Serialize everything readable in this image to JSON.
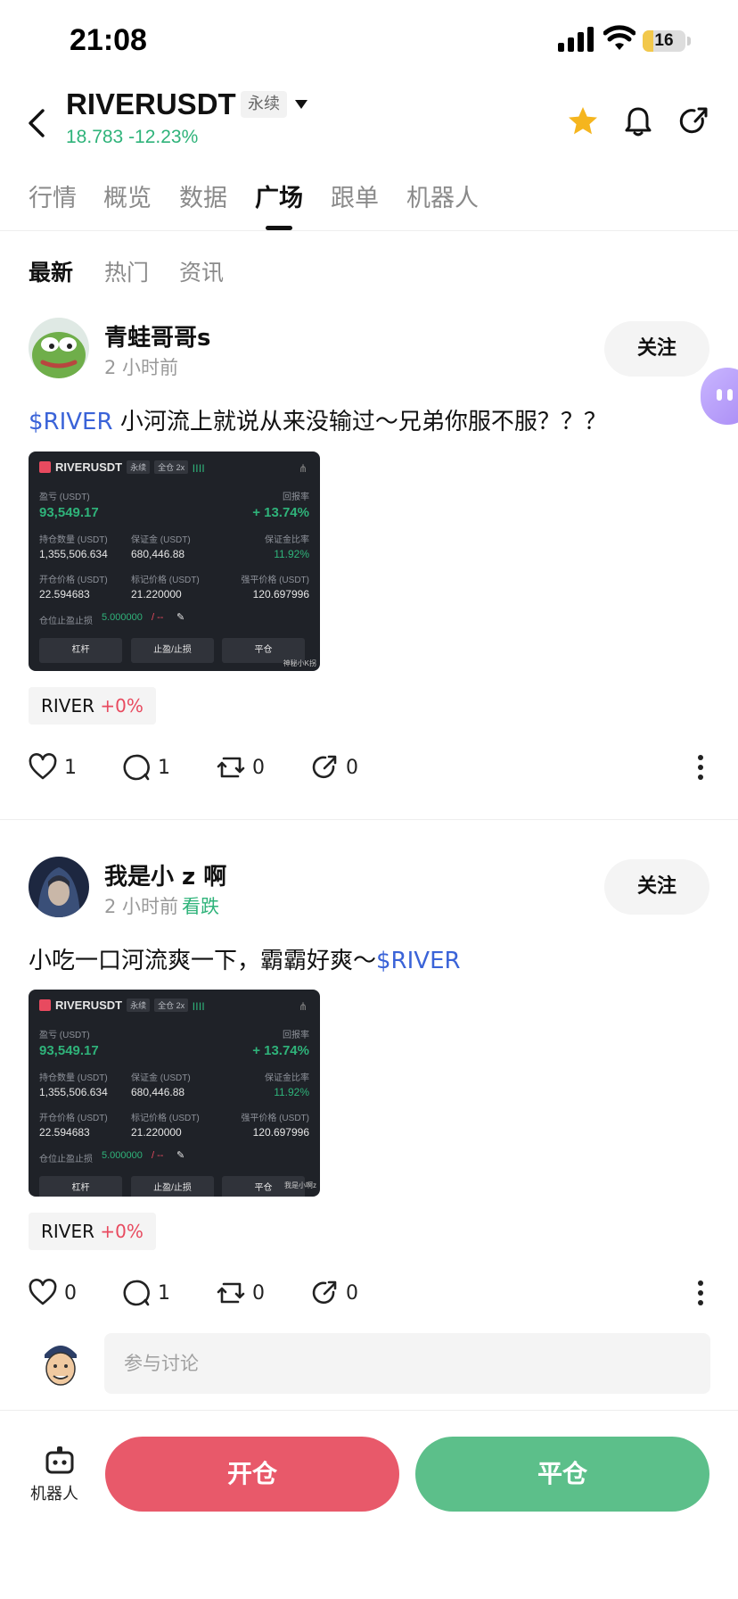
{
  "status_bar": {
    "time": "21:08",
    "battery": "16"
  },
  "header": {
    "title": "RIVERUSDT",
    "badge": "永续",
    "price_line": "18.783 -12.23%"
  },
  "tabs": [
    "行情",
    "概览",
    "数据",
    "广场",
    "跟单",
    "机器人"
  ],
  "active_tab": "广场",
  "subtabs": [
    "最新",
    "热门",
    "资讯"
  ],
  "active_subtab": "最新",
  "posts": [
    {
      "username": "青蛙哥哥s",
      "time": "2 小时前",
      "sentiment": "",
      "follow": "关注",
      "ticker": "$RIVER",
      "text_after": " 小河流上就说从来没输过～兄弟你服不服？？？",
      "card": {
        "symbol": "RIVERUSDT",
        "perp": "永续",
        "margin": "全仓 2x",
        "pnl_label": "盈亏 (USDT)",
        "pnl": "93,549.17",
        "roe_label": "回报率",
        "roe": "+ 13.74%",
        "qty_label": "持仓数量 (USDT)",
        "qty": "1,355,506.634",
        "margin_label": "保证金 (USDT)",
        "margin_val": "680,446.88",
        "ratio_label": "保证金比率",
        "ratio": "11.92%",
        "entry_label": "开仓价格 (USDT)",
        "entry": "22.594683",
        "mark_label": "标记价格 (USDT)",
        "mark": "21.220000",
        "liq_label": "强平价格 (USDT)",
        "liq": "120.697996",
        "tpsl_label": "仓位止盈止损",
        "tpsl": "5.000000",
        "tpsl_tail": "/ --",
        "btn1": "杠杆",
        "btn2": "止盈/止损",
        "btn3": "平仓",
        "watermark": "神秘小K拐"
      },
      "tag": {
        "name": "RIVER",
        "change": "+0%"
      },
      "stats": {
        "likes": "1",
        "comments": "1",
        "reposts": "0",
        "shares": "0"
      }
    },
    {
      "username": "我是小 z 啊",
      "time": "2 小时前",
      "sentiment": "看跌",
      "follow": "关注",
      "text_before": "小吃一口河流爽一下，霸霸好爽～",
      "ticker": "$RIVER",
      "card": {
        "symbol": "RIVERUSDT",
        "perp": "永续",
        "margin": "全仓 2x",
        "pnl_label": "盈亏 (USDT)",
        "pnl": "93,549.17",
        "roe_label": "回报率",
        "roe": "+ 13.74%",
        "qty_label": "持仓数量 (USDT)",
        "qty": "1,355,506.634",
        "margin_label": "保证金 (USDT)",
        "margin_val": "680,446.88",
        "ratio_label": "保证金比率",
        "ratio": "11.92%",
        "entry_label": "开仓价格 (USDT)",
        "entry": "22.594683",
        "mark_label": "标记价格 (USDT)",
        "mark": "21.220000",
        "liq_label": "强平价格 (USDT)",
        "liq": "120.697996",
        "tpsl_label": "仓位止盈止损",
        "tpsl": "5.000000",
        "tpsl_tail": "/ --",
        "btn1": "杠杆",
        "btn2": "止盈/止损",
        "btn3": "平仓",
        "watermark": "我是小啊z"
      },
      "tag": {
        "name": "RIVER",
        "change": "+0%"
      },
      "stats": {
        "likes": "0",
        "comments": "1",
        "reposts": "0",
        "shares": "0"
      }
    }
  ],
  "comment": {
    "placeholder": "参与讨论"
  },
  "bottom_bar": {
    "robot_label": "机器人",
    "open_label": "开仓",
    "close_label": "平仓"
  },
  "colors": {
    "up": "#2fb37a",
    "down": "#e8596a",
    "ticker": "#3a63d8",
    "star": "#f5b51e"
  }
}
